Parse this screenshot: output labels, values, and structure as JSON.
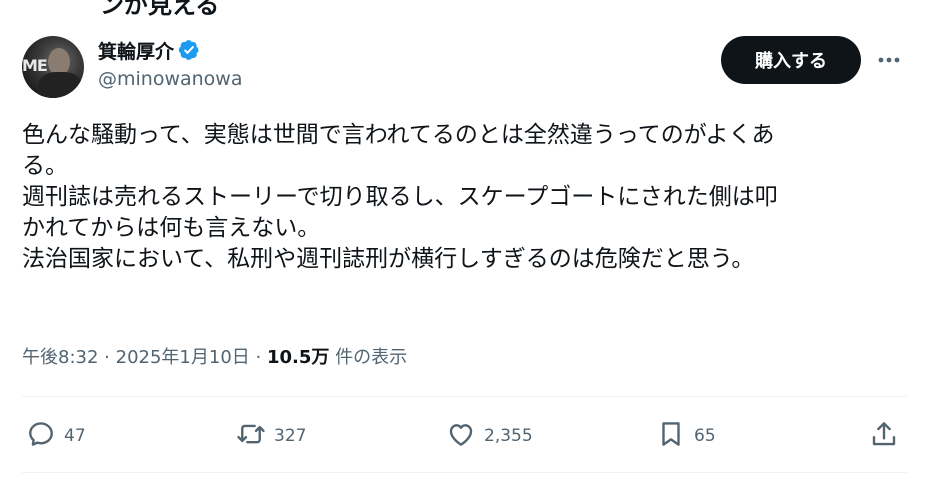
{
  "top_cutoff_text": "ンが見える",
  "author": {
    "display_name": "箕輪厚介",
    "handle": "@minowanowa",
    "avatar_sign_text": "ME"
  },
  "buy_button": {
    "label": "購入する"
  },
  "tweet": {
    "lines": [
      "色んな騒動って、実態は世間で言われてるのとは全然違うってのがよくあ",
      "る。",
      "週刊誌は売れるストーリーで切り取るし、スケープゴートにされた側は叩",
      "かれてからは何も言えない。",
      "法治国家において、私刑や週刊誌刑が横行しすぎるのは危険だと思う。"
    ]
  },
  "meta": {
    "time": "午後8:32",
    "separator": "·",
    "date": "2025年1月10日",
    "views_count": "10.5万",
    "views_label": "件の表示"
  },
  "actions": {
    "reply": {
      "icon": "reply-icon",
      "count": "47"
    },
    "retweet": {
      "icon": "retweet-icon",
      "count": "327"
    },
    "like": {
      "icon": "heart-icon",
      "count": "2,355"
    },
    "bookmark": {
      "icon": "bookmark-icon",
      "count": "65"
    },
    "share": {
      "icon": "share-icon"
    }
  },
  "colors": {
    "text_primary": "#0f1419",
    "text_secondary": "#536471",
    "verified_blue": "#1d9bf0",
    "button_bg": "#0f1419",
    "divider": "#eff3f4"
  }
}
